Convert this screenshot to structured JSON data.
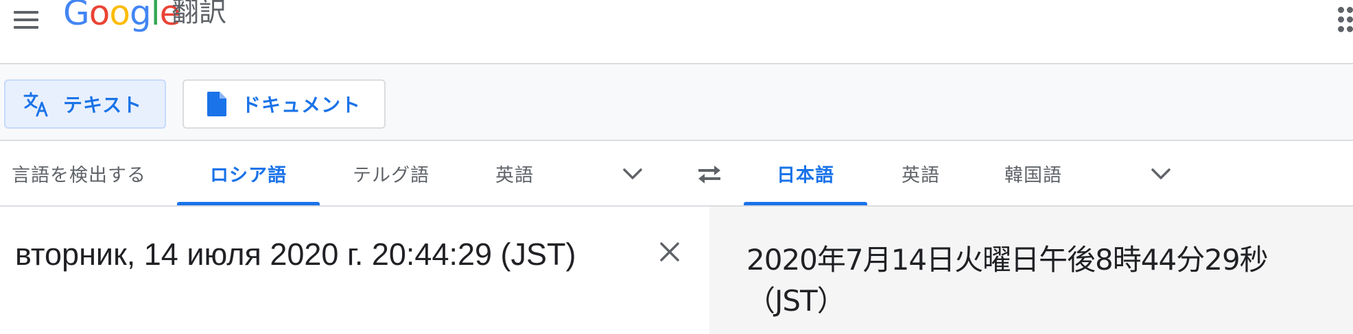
{
  "header": {
    "logo": {
      "letters": [
        "G",
        "o",
        "o",
        "g",
        "l",
        "e"
      ]
    },
    "app_name": "翻訳",
    "menu_icon": "hamburger-icon",
    "apps_icon": "apps-grid-icon"
  },
  "modes": [
    {
      "label": "テキスト",
      "icon": "translate-icon",
      "selected": true
    },
    {
      "label": "ドキュメント",
      "icon": "document-icon",
      "selected": false
    }
  ],
  "source_languages": [
    {
      "label": "言語を検出する",
      "selected": false
    },
    {
      "label": "ロシア語",
      "selected": true
    },
    {
      "label": "テルグ語",
      "selected": false
    },
    {
      "label": "英語",
      "selected": false
    }
  ],
  "target_languages": [
    {
      "label": "日本語",
      "selected": true
    },
    {
      "label": "英語",
      "selected": false
    },
    {
      "label": "韓国語",
      "selected": false
    }
  ],
  "source": {
    "text": "вторник, 14 июля 2020 г. 20:44:29 (JST)",
    "clear_icon": "close-icon"
  },
  "target": {
    "lines": [
      "2020年7月14日火曜日午後8時44分29秒",
      "（JST）"
    ]
  },
  "colors": {
    "accent": "#1a73e8",
    "selected_mode_bg": "#e8f0fe",
    "target_pane_bg": "#f5f5f5"
  }
}
